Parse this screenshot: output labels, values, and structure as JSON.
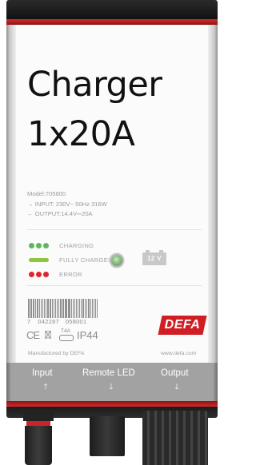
{
  "device": {
    "title_line1": "Charger",
    "title_line2": "1x20A",
    "specs": {
      "model": "Model:705800",
      "input": "→ INPUT: 230V~ 50Hz 316W",
      "output": "← OUTPUT:14.4V⎓20A"
    },
    "indicators": [
      {
        "label": "CHARGING",
        "style": "dots",
        "color": "#5cb85c"
      },
      {
        "label": "FULLY CHARGED",
        "style": "bar",
        "color": "#8dc63f"
      },
      {
        "label": "ERROR",
        "style": "dots",
        "color": "#e0242c"
      }
    ],
    "battery_label": "12 V",
    "barcode": {
      "lead": "7",
      "group1": "042287",
      "group2": "058001"
    },
    "certifications": {
      "ce": "CE",
      "fuse": "T4A",
      "ip": "IP44"
    },
    "brand": "DEFA",
    "manufacturer": "Manufactured by DEFA",
    "website": "www.defa.com",
    "ports": [
      {
        "label": "Input",
        "arrow": "🡑"
      },
      {
        "label": "Remote LED",
        "arrow": "🡓"
      },
      {
        "label": "Output",
        "arrow": "🡓"
      }
    ]
  },
  "colors": {
    "accent_red": "#cf1f25",
    "charging_green": "#5cb85c",
    "full_green": "#8dc63f",
    "error_red": "#e0242c"
  }
}
